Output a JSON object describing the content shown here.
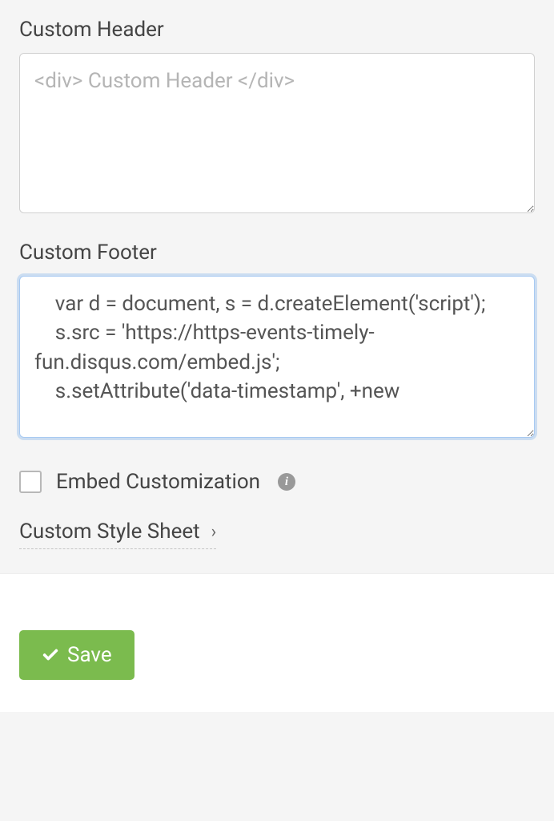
{
  "fields": {
    "custom_header": {
      "label": "Custom Header",
      "placeholder": "<div> Custom Header </div>",
      "value": ""
    },
    "custom_footer": {
      "label": "Custom Footer",
      "value": "    var d = document, s = d.createElement('script');\n    s.src = 'https://https-events-timely-fun.disqus.com/embed.js';\n    s.setAttribute('data-timestamp', +new "
    },
    "embed_customization": {
      "label": "Embed Customization",
      "checked": false
    },
    "custom_style_sheet": {
      "label": "Custom Style Sheet"
    }
  },
  "buttons": {
    "save_label": "Save"
  }
}
